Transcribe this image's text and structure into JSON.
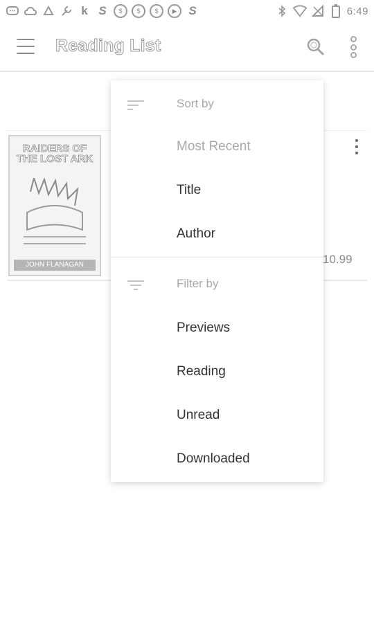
{
  "status_bar": {
    "time": "6:49",
    "left_icons": [
      "message-icon",
      "cloud-icon",
      "recycle-icon",
      "wrench-icon",
      "k-icon",
      "s-icon",
      "dollar-icon",
      "dollar-icon",
      "dollar-icon",
      "play-icon",
      "s-icon"
    ],
    "right_icons": [
      "bluetooth-icon",
      "wifi-icon",
      "no-signal-icon",
      "battery-icon"
    ]
  },
  "app_bar": {
    "title": "Reading List"
  },
  "book": {
    "cover_title": "RAIDERS OF THE LOST ARK",
    "cover_author": "JOHN FLANAGAN",
    "price": "10.99"
  },
  "menu": {
    "sort_header": "Sort by",
    "sort_items": [
      {
        "label": "Most Recent",
        "selected": true
      },
      {
        "label": "Title",
        "selected": false
      },
      {
        "label": "Author",
        "selected": false
      }
    ],
    "filter_header": "Filter by",
    "filter_items": [
      {
        "label": "Previews"
      },
      {
        "label": "Reading"
      },
      {
        "label": "Unread"
      },
      {
        "label": "Downloaded"
      }
    ]
  },
  "colors": {
    "icon_gray": "#8e8e8e",
    "text_primary": "#333333",
    "text_disabled": "#a9a9a9"
  }
}
